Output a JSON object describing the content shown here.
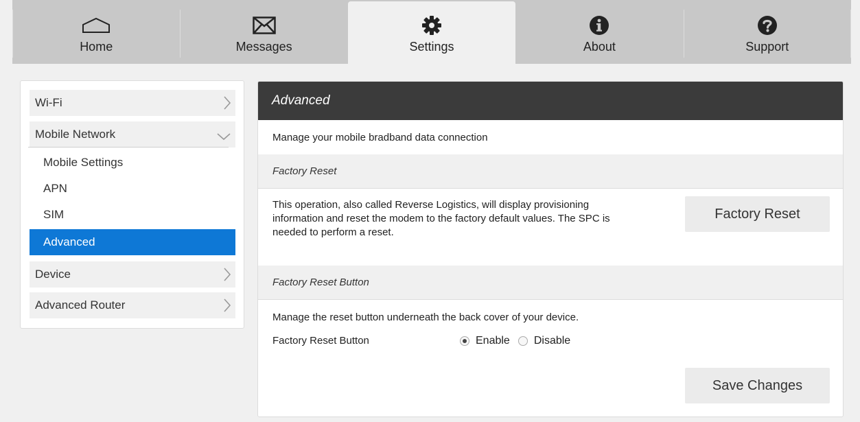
{
  "nav": {
    "tabs": [
      {
        "label": "Home",
        "icon": "home-icon",
        "active": false
      },
      {
        "label": "Messages",
        "icon": "envelope-icon",
        "active": false
      },
      {
        "label": "Settings",
        "icon": "gear-icon",
        "active": true
      },
      {
        "label": "About",
        "icon": "info-icon",
        "active": false
      },
      {
        "label": "Support",
        "icon": "question-icon",
        "active": false
      }
    ]
  },
  "sidebar": {
    "items": [
      {
        "label": "Wi-Fi",
        "icon": "chevron-right-icon"
      },
      {
        "label": "Mobile Network",
        "icon": "chevron-down-icon",
        "expanded": true
      },
      {
        "label": "Device",
        "icon": "chevron-right-icon"
      },
      {
        "label": "Advanced Router",
        "icon": "chevron-right-icon"
      }
    ],
    "mobile_network_subitems": [
      {
        "label": "Mobile Settings",
        "active": false
      },
      {
        "label": "APN",
        "active": false
      },
      {
        "label": "SIM",
        "active": false
      },
      {
        "label": "Advanced",
        "active": true
      }
    ]
  },
  "panel": {
    "title": "Advanced",
    "description": "Manage your mobile bradband data connection",
    "factory_reset": {
      "heading": "Factory Reset",
      "text": "This operation, also called Reverse Logistics, will display provisioning information and reset the modem to the factory default values. The SPC is needed to perform a reset.",
      "button_label": "Factory Reset"
    },
    "factory_reset_button": {
      "heading": "Factory Reset Button",
      "description": "Manage the reset button underneath the back cover of your device.",
      "label": "Factory Reset Button",
      "options": [
        "Enable",
        "Disable"
      ],
      "selected": "Enable"
    },
    "save_label": "Save Changes"
  },
  "colors": {
    "accent": "#0e78d6",
    "header_bg": "#3b3b3b",
    "nav_bg": "#c8c8c8",
    "page_bg": "#f0f0f0"
  }
}
